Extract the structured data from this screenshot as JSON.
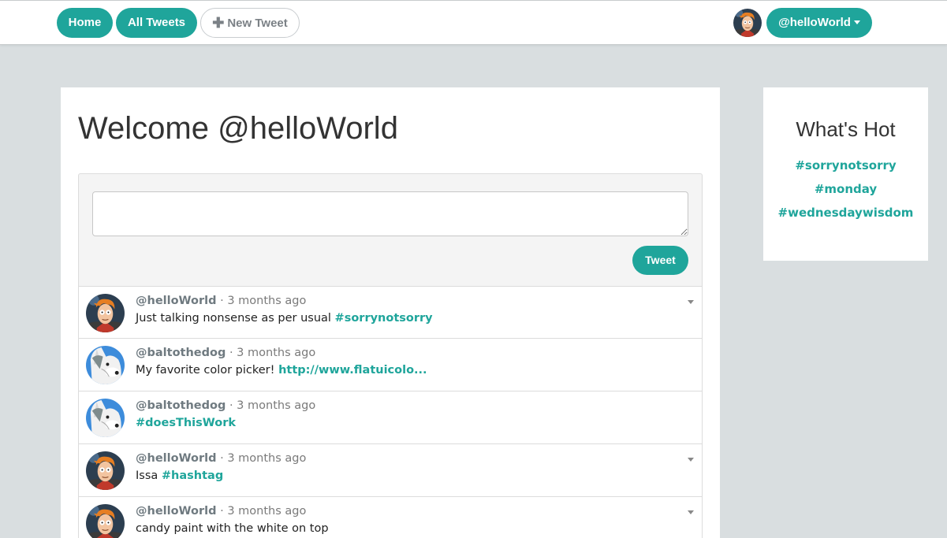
{
  "nav": {
    "home_label": "Home",
    "all_tweets_label": "All Tweets",
    "new_tweet_label": "New Tweet",
    "new_tweet_icon": "plus-icon",
    "user_menu_label": "@helloWorld",
    "accent_color": "#1fa59b"
  },
  "main": {
    "welcome_title": "Welcome @helloWorld",
    "compose": {
      "textarea_value": "",
      "tweet_button_label": "Tweet"
    },
    "tweets": [
      {
        "handle": "@helloWorld",
        "time": "· 3 months ago",
        "text": "Just talking nonsense as per usual ",
        "tag": "#sorrynotsorry",
        "avatar": "fry-avatar",
        "has_menu": true
      },
      {
        "handle": "@baltothedog",
        "time": "· 3 months ago",
        "text": "My favorite color picker! ",
        "tag": "http://www.flatuicolo...",
        "avatar": "husky-avatar",
        "has_menu": false
      },
      {
        "handle": "@baltothedog",
        "time": "· 3 months ago",
        "text": "",
        "tag": "#doesThisWork",
        "avatar": "husky-avatar",
        "has_menu": false
      },
      {
        "handle": "@helloWorld",
        "time": "· 3 months ago",
        "text": "Issa ",
        "tag": "#hashtag",
        "avatar": "fry-avatar",
        "has_menu": true
      },
      {
        "handle": "@helloWorld",
        "time": "· 3 months ago",
        "text": "candy paint with the white on top",
        "tag": "",
        "avatar": "fry-avatar",
        "has_menu": true
      }
    ]
  },
  "sidebar": {
    "title": "What's Hot",
    "hashtags": [
      "#sorrynotsorry",
      "#monday",
      "#wednesdaywisdom"
    ]
  }
}
